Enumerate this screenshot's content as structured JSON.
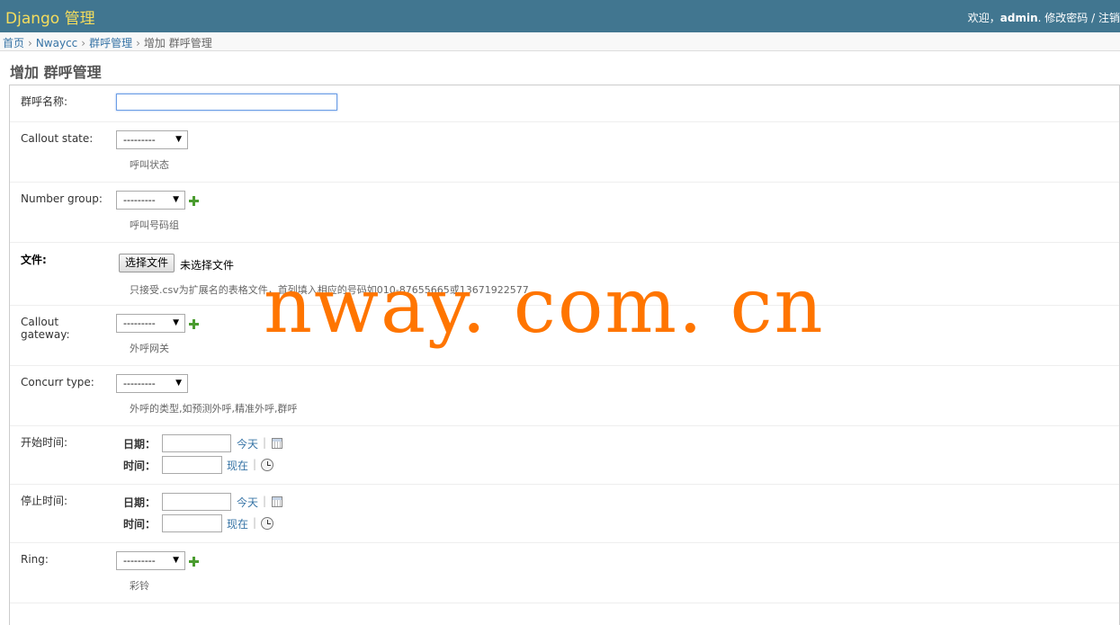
{
  "header": {
    "branding": "Django 管理",
    "welcome": "欢迎，",
    "username": "admin",
    "change_password": "修改密码",
    "separator": "/",
    "logout": "注销"
  },
  "breadcrumbs": {
    "home": "首页",
    "app": "Nwaycc",
    "model": "群呼管理",
    "current": "增加 群呼管理",
    "sep": "›"
  },
  "page_title": "增加 群呼管理",
  "form": {
    "name": {
      "label": "群呼名称:",
      "value": ""
    },
    "callout_state": {
      "label": "Callout state:",
      "selected": "---------",
      "help": "呼叫状态"
    },
    "number_group": {
      "label": "Number group:",
      "selected": "---------",
      "help": "呼叫号码组"
    },
    "file": {
      "label": "文件:",
      "button": "选择文件",
      "status": "未选择文件",
      "help": "只接受.csv为扩展名的表格文件，首列填入相应的号码如010-87655665或13671922577"
    },
    "callout_gateway": {
      "label_line1": "Callout",
      "label_line2": "gateway:",
      "selected": "---------",
      "help": "外呼网关"
    },
    "concurr_type": {
      "label": "Concurr type:",
      "selected": "---------",
      "help": "外呼的类型,如预测外呼,精准外呼,群呼"
    },
    "start_time": {
      "label": "开始时间:",
      "date_label": "日期：",
      "today": "今天",
      "time_label": "时间：",
      "now": "现在"
    },
    "stop_time": {
      "label": "停止时间:",
      "date_label": "日期：",
      "today": "今天",
      "time_label": "时间：",
      "now": "现在"
    },
    "ring": {
      "label": "Ring:",
      "selected": "---------",
      "help": "彩铃"
    },
    "link_separator": "|"
  },
  "watermark": "nway. com. cn",
  "icons": {
    "add": "add-icon",
    "calendar": "calendar-icon",
    "clock": "clock-icon",
    "dropdown": "dropdown-arrow-icon"
  },
  "colors": {
    "header_bg": "#417690",
    "branding": "#f5dd5d",
    "link": "#3774a6",
    "add_icon": "#4a9c2f",
    "watermark": "#ff7500"
  }
}
